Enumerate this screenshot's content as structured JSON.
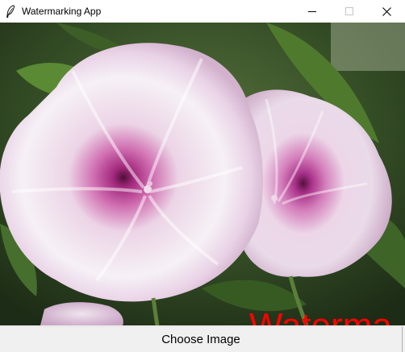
{
  "window": {
    "title": "Watermarking App",
    "controls": {
      "minimize": "minimize-icon",
      "maximize": "maximize-icon",
      "close": "close-icon"
    }
  },
  "canvas": {
    "image": "flower-photo",
    "watermark_text": "Waterma",
    "watermark_color": "#ff0000"
  },
  "actions": {
    "choose_image_label": "Choose Image"
  }
}
